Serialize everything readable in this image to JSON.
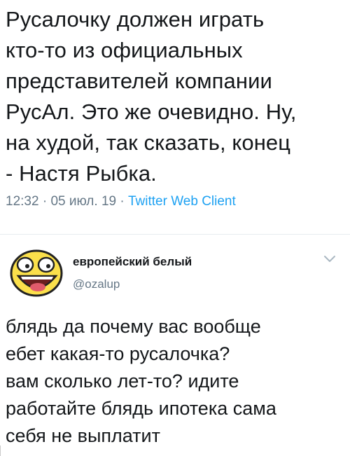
{
  "tweet": {
    "text": "Русалочку должен играть\nкто-то из официальных\nпредставителей компании\nРусАл. Это же очевидно. Ну,\nна худой, так сказать, конец\n- Настя Рыбка.",
    "time": "12:32",
    "separator": "·",
    "date": "05 июл. 19",
    "client": "Twitter Web Client"
  },
  "reply": {
    "display_name": "европейский белый",
    "handle": "@ozalup",
    "text": "блядь да почему вас вообще\nебет какая-то русалочка?\nвам сколько лет-то? идите\nработайте блядь ипотека сама\nсебя не выплатит",
    "avatar_icon": "awesome-face-icon",
    "menu_icon": "chevron-down-icon"
  },
  "colors": {
    "text": "#14171a",
    "muted": "#657786",
    "link": "#1da1f2",
    "avatar_fill": "#fbe04b"
  }
}
